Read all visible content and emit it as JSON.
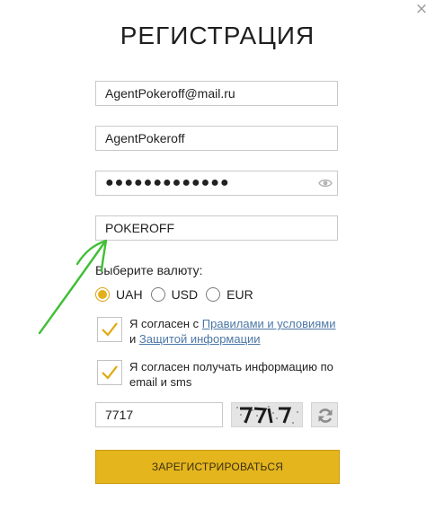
{
  "dialog": {
    "title": "РЕГИСТРАЦИЯ",
    "close_icon": "×"
  },
  "form": {
    "email": "AgentPokeroff@mail.ru",
    "username": "AgentPokeroff",
    "password_masked": "●●●●●●●●●●●●●",
    "promo_code": "POKEROFF",
    "currency": {
      "label": "Выберите валюту:",
      "options": [
        "UAH",
        "USD",
        "EUR"
      ],
      "selected": "UAH"
    },
    "terms": {
      "text_prefix": "Я согласен с ",
      "link_rules": "Правилами и условиями",
      "text_and": " и ",
      "link_privacy": "Защитой информации",
      "checked": true
    },
    "newsletter": {
      "text": "Я согласен получать информацию по email и sms",
      "checked": true
    },
    "captcha": {
      "value": "7717"
    },
    "submit_label": "ЗАРЕГИСТРИРОВАТЬСЯ"
  },
  "colors": {
    "accent": "#e5b51e",
    "checkmark": "#e0a90e",
    "link": "#4c77a6",
    "annotation_arrow": "#3fbf35"
  },
  "icons": [
    "close-icon",
    "eye-icon",
    "refresh-icon",
    "checkmark-icon"
  ]
}
